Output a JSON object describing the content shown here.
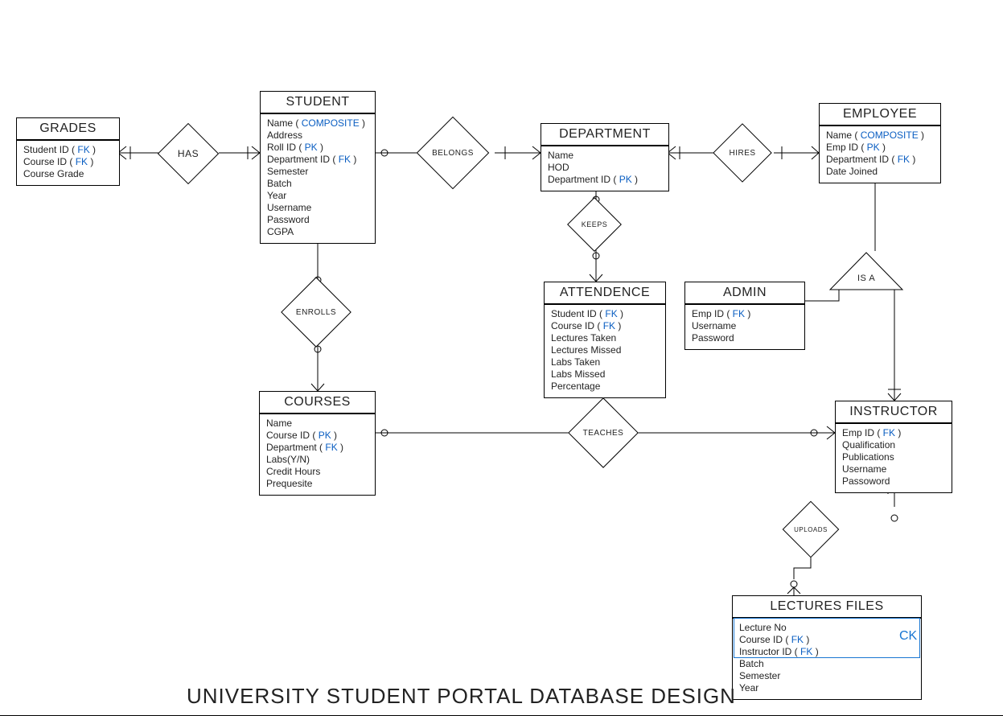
{
  "title": "UNIVERSITY STUDENT PORTAL DATABASE DESIGN",
  "key_color": "#0a5ec2",
  "entities": {
    "grades": {
      "title": "GRADES",
      "attrs": [
        {
          "name": "Student ID",
          "keys": [
            "FK"
          ]
        },
        {
          "name": "Course ID",
          "keys": [
            "FK"
          ]
        },
        {
          "name": "Course Grade"
        }
      ]
    },
    "student": {
      "title": "STUDENT",
      "attrs": [
        {
          "name": "Name",
          "keys": [
            "COMPOSITE"
          ]
        },
        {
          "name": "Address"
        },
        {
          "name": "Roll ID",
          "keys": [
            "PK"
          ]
        },
        {
          "name": "Department ID",
          "keys": [
            "FK"
          ]
        },
        {
          "name": "Semester"
        },
        {
          "name": "Batch"
        },
        {
          "name": "Year"
        },
        {
          "name": "Username"
        },
        {
          "name": "Password"
        },
        {
          "name": "CGPA"
        }
      ]
    },
    "department": {
      "title": "DEPARTMENT",
      "attrs": [
        {
          "name": "Name"
        },
        {
          "name": "HOD"
        },
        {
          "name": "Department ID",
          "keys": [
            "PK"
          ]
        }
      ]
    },
    "employee": {
      "title": "EMPLOYEE",
      "attrs": [
        {
          "name": "Name",
          "keys": [
            "COMPOSITE"
          ]
        },
        {
          "name": "Emp ID",
          "keys": [
            "PK"
          ]
        },
        {
          "name": "Department ID",
          "keys": [
            "FK"
          ]
        },
        {
          "name": "Date Joined"
        }
      ]
    },
    "attendance": {
      "title": "ATTENDENCE",
      "attrs": [
        {
          "name": "Student ID",
          "keys": [
            "FK"
          ]
        },
        {
          "name": "Course ID",
          "keys": [
            "FK"
          ]
        },
        {
          "name": "Lectures Taken"
        },
        {
          "name": "Lectures Missed"
        },
        {
          "name": "Labs Taken"
        },
        {
          "name": "Labs Missed"
        },
        {
          "name": "Percentage"
        }
      ]
    },
    "admin": {
      "title": "ADMIN",
      "attrs": [
        {
          "name": "Emp ID",
          "keys": [
            "FK"
          ]
        },
        {
          "name": "Username"
        },
        {
          "name": "Password"
        }
      ]
    },
    "courses": {
      "title": "COURSES",
      "attrs": [
        {
          "name": "Name"
        },
        {
          "name": "Course ID",
          "keys": [
            "PK"
          ]
        },
        {
          "name": "Department",
          "keys": [
            "FK"
          ]
        },
        {
          "name": "Labs(Y/N)"
        },
        {
          "name": "Credit Hours"
        },
        {
          "name": "Prequesite"
        }
      ]
    },
    "instructor": {
      "title": "INSTRUCTOR",
      "attrs": [
        {
          "name": "Emp ID",
          "keys": [
            "FK"
          ]
        },
        {
          "name": "Qualification"
        },
        {
          "name": "Publications"
        },
        {
          "name": "Username"
        },
        {
          "name": "Passoword"
        }
      ]
    },
    "lectures": {
      "title": "LECTURES FILES",
      "attrs": [
        {
          "name": "Lecture No"
        },
        {
          "name": "Course ID",
          "keys": [
            "FK"
          ]
        },
        {
          "name": "Instructor ID",
          "keys": [
            "FK"
          ]
        },
        {
          "name": "Batch"
        },
        {
          "name": "Semester"
        },
        {
          "name": "Year"
        }
      ]
    }
  },
  "relationships": {
    "has": "HAS",
    "belongs": "BELONGS",
    "hires": "HIRES",
    "keeps": "KEEPS",
    "enrolls": "ENROLLS",
    "teaches": "TEACHES",
    "uploads": "UPLOADS",
    "isa": "IS A"
  },
  "ck_label": "CK"
}
